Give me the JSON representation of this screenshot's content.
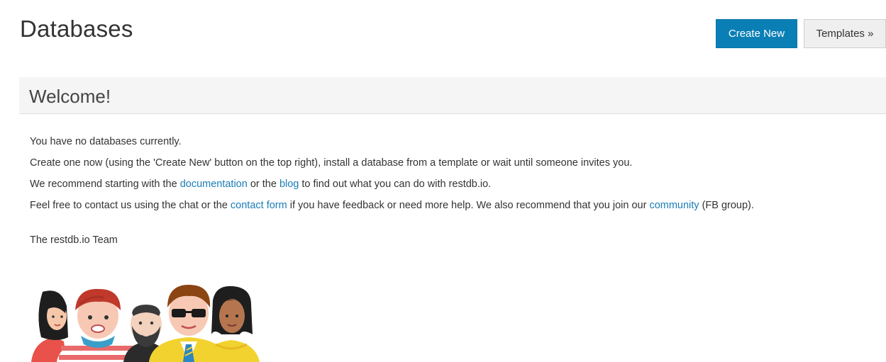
{
  "header": {
    "title": "Databases",
    "create_new_label": "Create New",
    "templates_label": "Templates »"
  },
  "welcome": {
    "title": "Welcome!",
    "line1": "You have no databases currently.",
    "line2": "Create one now (using the 'Create New' button on the top right), install a database from a template or wait until someone invites you.",
    "line3": {
      "prefix": "We recommend starting with the ",
      "documentation_link": "documentation",
      "middle": " or the ",
      "blog_link": "blog",
      "suffix": " to find out what you can do with restdb.io."
    },
    "line4": {
      "prefix": "Feel free to contact us using the chat or the ",
      "contact_link": "contact form",
      "middle": " if you have feedback or need more help. We also recommend that you join our ",
      "community_link": "community",
      "suffix": " (FB group)."
    },
    "signature": "The restdb.io Team"
  },
  "colors": {
    "primary_button": "#0a7fb5",
    "link": "#1a7db8",
    "header_bg": "#f5f5f5"
  },
  "icons": {
    "team_illustration": "team-people-illustration"
  }
}
